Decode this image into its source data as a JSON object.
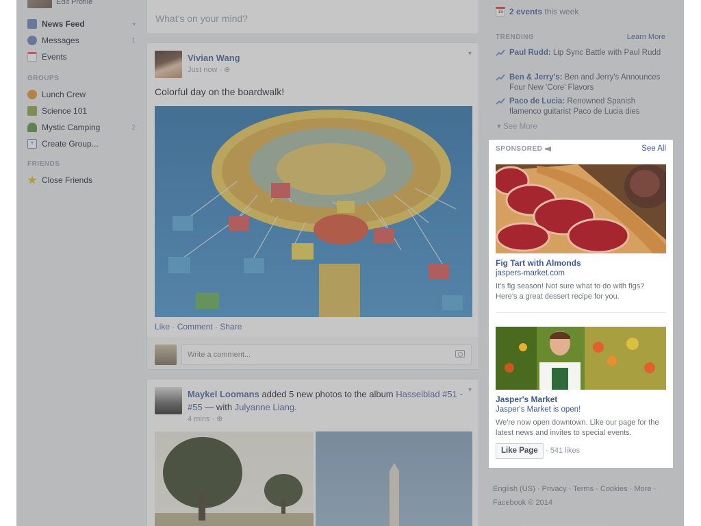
{
  "left_nav": {
    "profile_label": "Edit Profile",
    "items": [
      {
        "label": "News Feed",
        "badge": "▾"
      },
      {
        "label": "Messages",
        "badge": "1"
      },
      {
        "label": "Events",
        "badge": ""
      }
    ],
    "groups_label": "GROUPS",
    "groups": [
      {
        "label": "Lunch Crew",
        "badge": ""
      },
      {
        "label": "Science 101",
        "badge": ""
      },
      {
        "label": "Mystic Camping",
        "badge": "2"
      },
      {
        "label": "Create Group...",
        "badge": ""
      }
    ],
    "friends_label": "FRIENDS",
    "friends": [
      {
        "label": "Close Friends"
      }
    ],
    "icon_colors": {
      "news_feed": "#5b7bb8",
      "messages": "#5b7bb8",
      "events": "#d9534f",
      "lunch_crew": "#e08a1e",
      "science": "#8a9a3a",
      "camping": "#4f8a3a",
      "create_group": "#5b7bb8",
      "close_friends": "#e0b020"
    }
  },
  "composer": {
    "placeholder": "What's on your mind?"
  },
  "post1": {
    "author": "Vivian Wang",
    "meta": "Just now · ⊕",
    "text": "Colorful day on the boardwalk!",
    "actions": {
      "like": "Like",
      "comment": "Comment",
      "share": "Share",
      "sep": " · "
    },
    "comment_placeholder": "Write a comment..."
  },
  "post2": {
    "author": "Maykel Loomans",
    "action_text": " added 5 new photos to the album ",
    "album": "Hasselblad #51 - #55",
    "with_text": " — with ",
    "tagged": "Julyanne Liang",
    "end": ".",
    "meta": "4 mins · ⊕"
  },
  "right": {
    "events_date": "18",
    "events_link": "2 events",
    "events_suffix": " this week",
    "trending_label": "TRENDING",
    "learn_more": "Learn More",
    "trends": [
      {
        "name": "Paul Rudd:",
        "text": " Lip Sync Battle with Paul Rudd"
      },
      {
        "name": "Ben & Jerry's:",
        "text": " Ben and Jerry's Announces Four New 'Core' Flavors"
      },
      {
        "name": "Paco de Lucia:",
        "text": " Renowned Spanish flamenco guitarist Paco de Lucia dies"
      }
    ],
    "see_more": "▾  See More"
  },
  "ads": {
    "sponsored_label": "SPONSORED",
    "see_all": "See All",
    "ad1": {
      "title": "Fig Tart with Almonds",
      "url": "jaspers-market.com",
      "body": "It's fig season! Not sure what to do with figs? Here's a great dessert recipe for you."
    },
    "ad2": {
      "title": "Jasper's Market",
      "url": "Jasper's Market is open!",
      "body": "We're now open downtown. Like our page for the latest news and invites to special events.",
      "button": "Like Page",
      "likes": "· 541 likes"
    }
  },
  "footer": {
    "links": "English (US) · Privacy · Terms · Cookies · More ·",
    "copyright": "Facebook © 2014"
  },
  "colors": {
    "brand_blue": "#3b5998",
    "page_bg": "#e9ebee",
    "muted": "#9197a3"
  }
}
